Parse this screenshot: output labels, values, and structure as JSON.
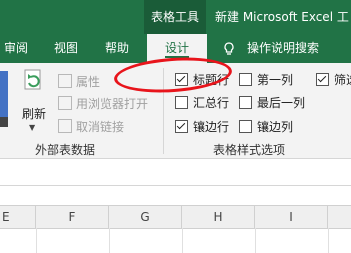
{
  "titlebar": {
    "context_tools": "表格工具",
    "title": "新建 Microsoft Excel 工"
  },
  "tabs": [
    "审阅",
    "视图",
    "帮助",
    "设计"
  ],
  "tell_me": "操作说明搜索",
  "external_data": {
    "refresh_label": "刷新",
    "commands": [
      "属性",
      "用浏览器打开",
      "取消链接"
    ],
    "group_label": "外部表数据"
  },
  "style_options": {
    "group_label": "表格样式选项",
    "items": [
      {
        "label": "标题行",
        "checked": true
      },
      {
        "label": "汇总行",
        "checked": false
      },
      {
        "label": "镶边行",
        "checked": true
      },
      {
        "label": "第一列",
        "checked": false
      },
      {
        "label": "最后一列",
        "checked": false
      },
      {
        "label": "镶边列",
        "checked": false
      },
      {
        "label": "筛选",
        "checked": true
      }
    ]
  },
  "columns": [
    "E",
    "F",
    "G",
    "H",
    "I"
  ],
  "colors": {
    "excel_green": "#217346",
    "highlight": "#e8141b"
  }
}
